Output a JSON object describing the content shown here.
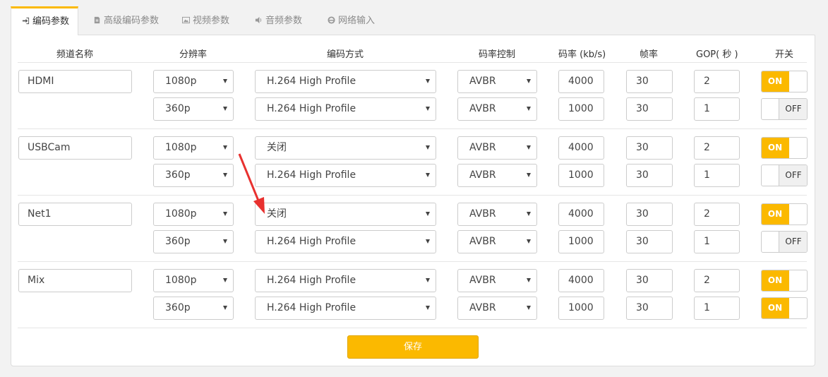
{
  "tabs": [
    {
      "label": "编码参数",
      "icon": "sign-in-icon",
      "active": true
    },
    {
      "label": "高级编码参数",
      "icon": "file-icon",
      "active": false
    },
    {
      "label": "视频参数",
      "icon": "image-icon",
      "active": false
    },
    {
      "label": "音频参数",
      "icon": "volume-icon",
      "active": false
    },
    {
      "label": "网络输入",
      "icon": "ie-icon",
      "active": false
    }
  ],
  "headers": {
    "channel": "频道名称",
    "resolution": "分辨率",
    "codec": "编码方式",
    "rate_control": "码率控制",
    "bitrate": "码率 (kb/s)",
    "fps": "帧率",
    "gop": "GOP( 秒 )",
    "switch": "开关"
  },
  "channels": [
    {
      "name": "HDMI",
      "streams": [
        {
          "resolution": "1080p",
          "codec": "H.264 High Profile",
          "rate_control": "AVBR",
          "bitrate": "4000",
          "fps": "30",
          "gop": "2",
          "switch": "ON"
        },
        {
          "resolution": "360p",
          "codec": "H.264 High Profile",
          "rate_control": "AVBR",
          "bitrate": "1000",
          "fps": "30",
          "gop": "1",
          "switch": "OFF"
        }
      ]
    },
    {
      "name": "USBCam",
      "streams": [
        {
          "resolution": "1080p",
          "codec": "关闭",
          "rate_control": "AVBR",
          "bitrate": "4000",
          "fps": "30",
          "gop": "2",
          "switch": "ON"
        },
        {
          "resolution": "360p",
          "codec": "H.264 High Profile",
          "rate_control": "AVBR",
          "bitrate": "1000",
          "fps": "30",
          "gop": "1",
          "switch": "OFF"
        }
      ]
    },
    {
      "name": "Net1",
      "streams": [
        {
          "resolution": "1080p",
          "codec": "关闭",
          "rate_control": "AVBR",
          "bitrate": "4000",
          "fps": "30",
          "gop": "2",
          "switch": "ON"
        },
        {
          "resolution": "360p",
          "codec": "H.264 High Profile",
          "rate_control": "AVBR",
          "bitrate": "1000",
          "fps": "30",
          "gop": "1",
          "switch": "OFF"
        }
      ]
    },
    {
      "name": "Mix",
      "streams": [
        {
          "resolution": "1080p",
          "codec": "H.264 High Profile",
          "rate_control": "AVBR",
          "bitrate": "4000",
          "fps": "30",
          "gop": "2",
          "switch": "ON"
        },
        {
          "resolution": "360p",
          "codec": "H.264 High Profile",
          "rate_control": "AVBR",
          "bitrate": "1000",
          "fps": "30",
          "gop": "1",
          "switch": "ON"
        }
      ]
    }
  ],
  "save_label": "保存",
  "colors": {
    "accent": "#fbb900",
    "annotation_arrow": "#e8312f"
  }
}
